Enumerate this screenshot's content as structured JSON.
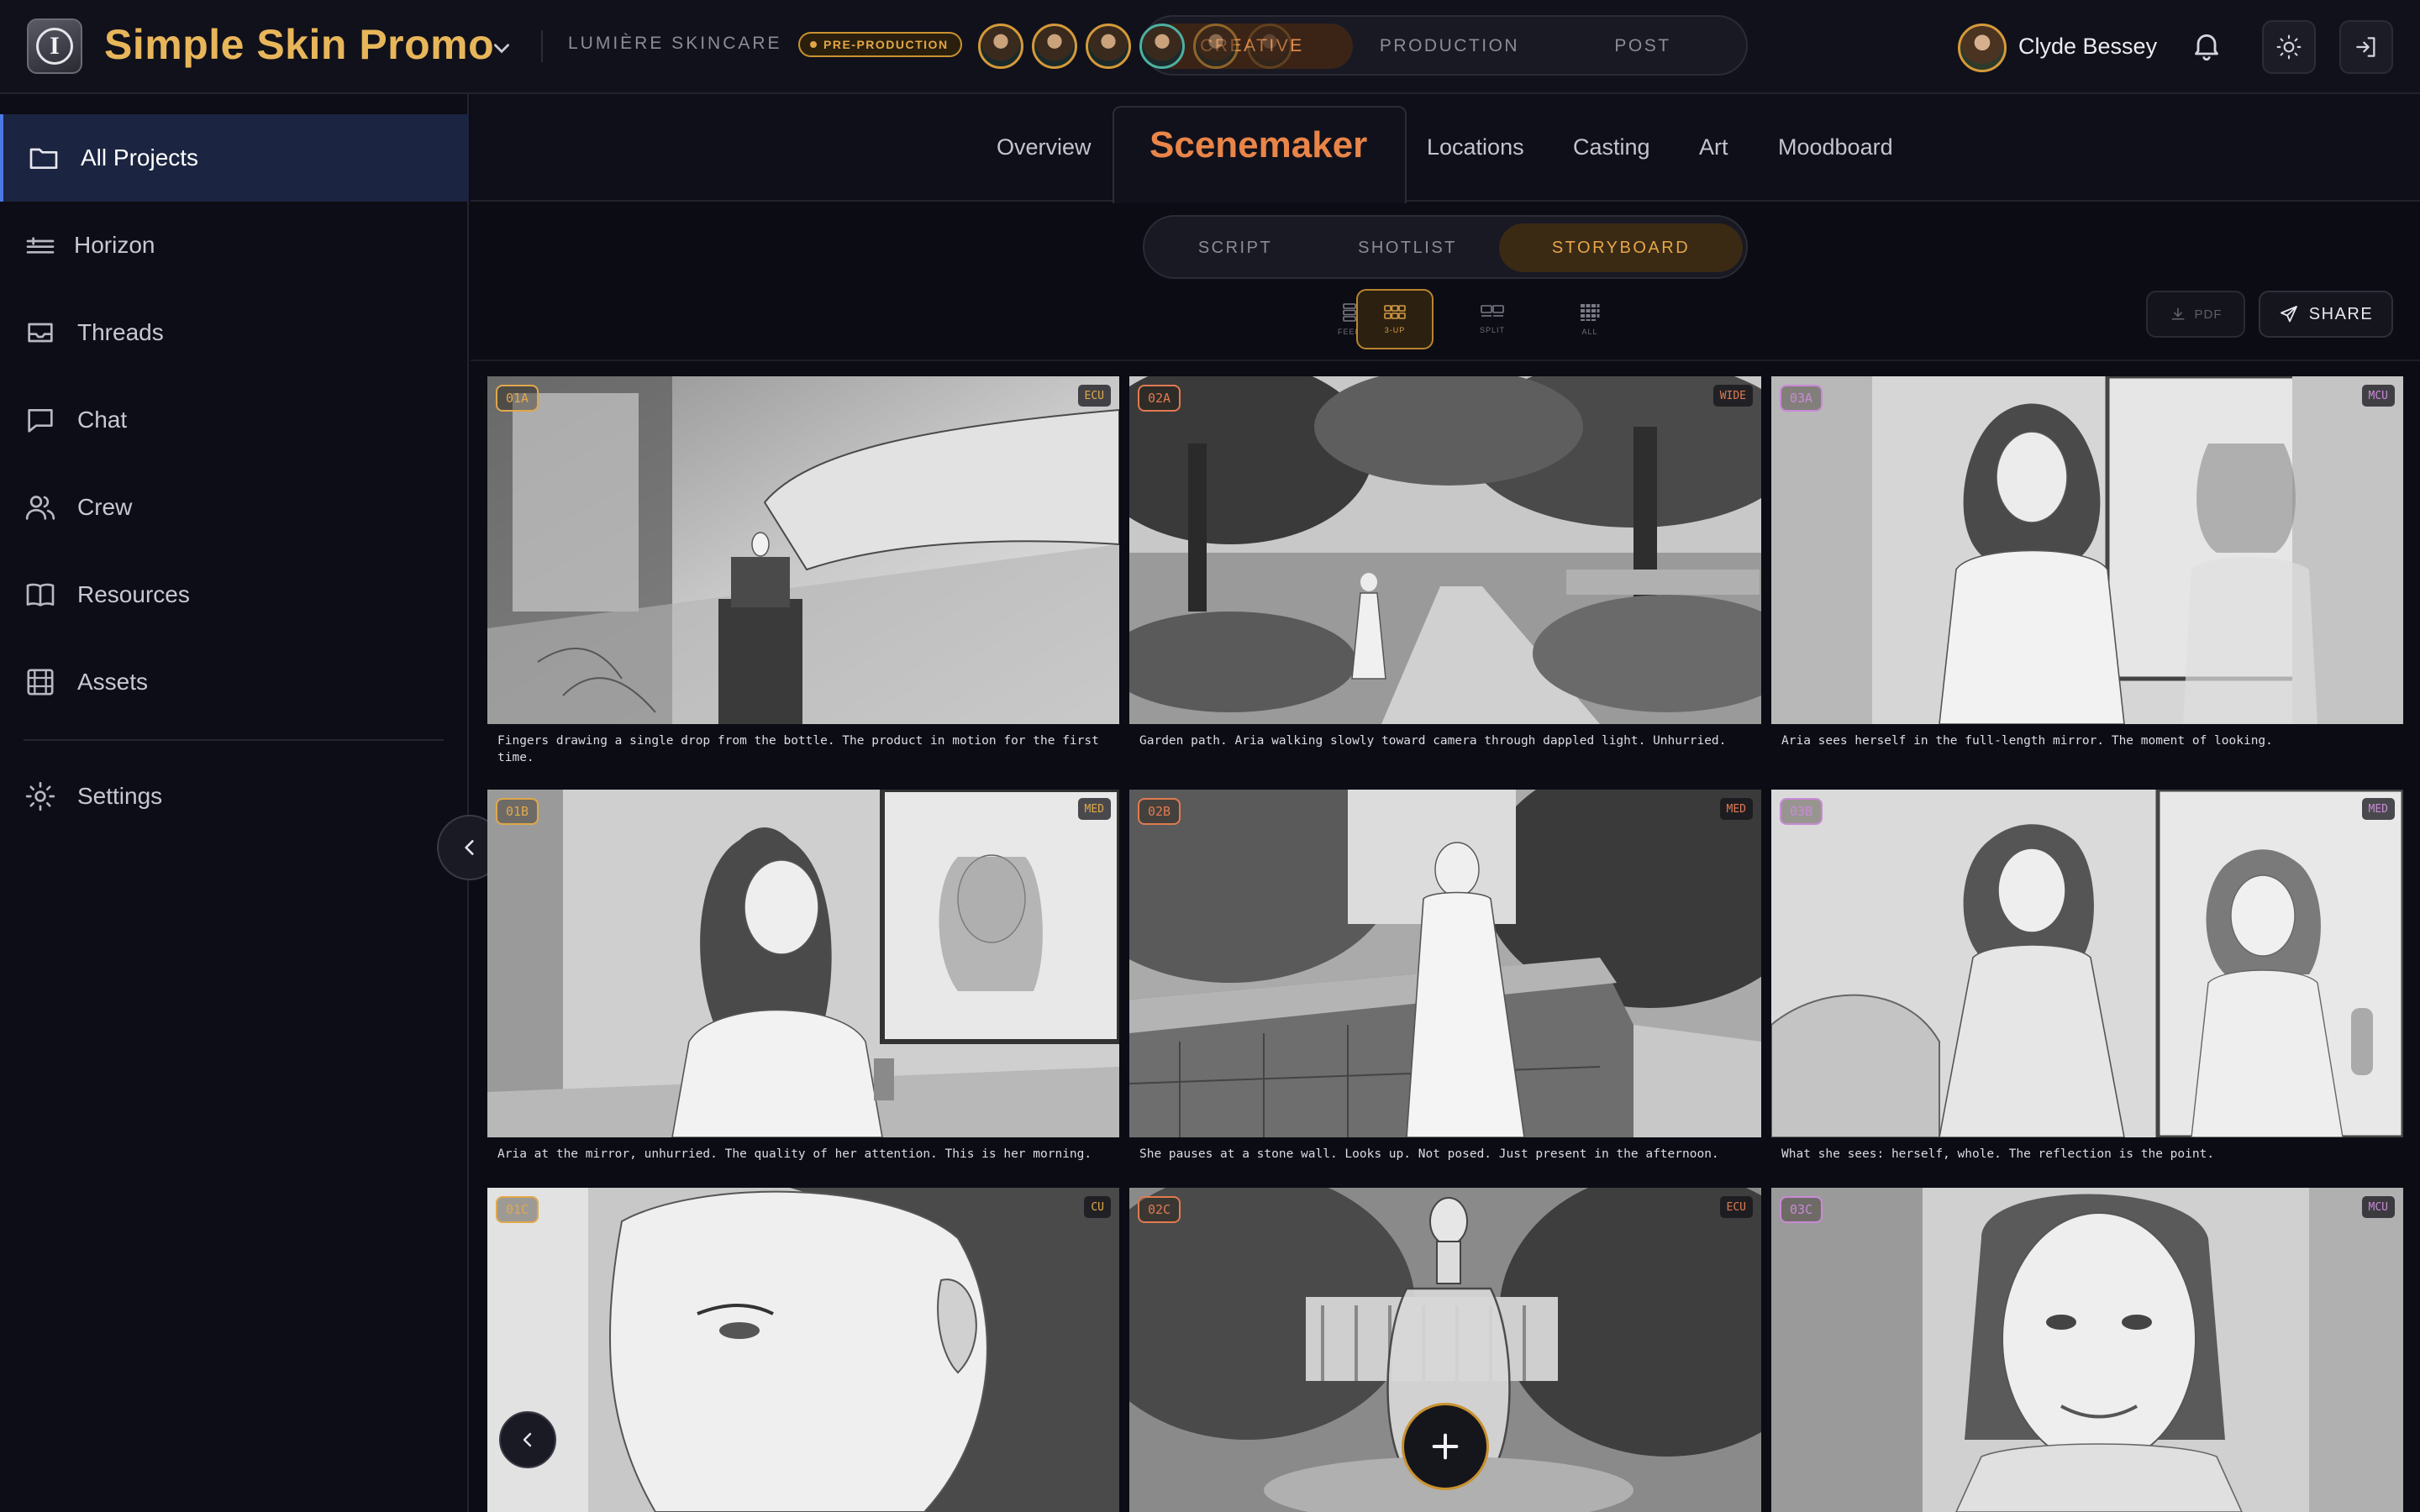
{
  "header": {
    "project_title": "Simple Skin Promo",
    "client": "LUMIÈRE SKINCARE",
    "stage_badge": "PRE-PRODUCTION",
    "phases": [
      "CREATIVE",
      "PRODUCTION",
      "POST"
    ],
    "active_phase": "CREATIVE",
    "user_name": "Clyde Bessey"
  },
  "sidebar": {
    "items": [
      {
        "label": "All Projects",
        "icon": "folder-icon",
        "active": true
      },
      {
        "label": "Horizon",
        "icon": "horizon-lines-icon"
      },
      {
        "label": "Threads",
        "icon": "inbox-icon"
      },
      {
        "label": "Chat",
        "icon": "chat-bubble-icon"
      },
      {
        "label": "Crew",
        "icon": "users-icon"
      },
      {
        "label": "Resources",
        "icon": "book-icon"
      },
      {
        "label": "Assets",
        "icon": "film-grid-icon"
      },
      {
        "label": "Settings",
        "icon": "gear-icon"
      }
    ]
  },
  "section_tabs": [
    "Overview",
    "Scenemaker",
    "Locations",
    "Casting",
    "Art",
    "Moodboard"
  ],
  "active_section": "Scenemaker",
  "view_tabs": [
    "SCRIPT",
    "SHOTLIST",
    "STORYBOARD"
  ],
  "active_view": "STORYBOARD",
  "layout_modes": [
    "FEED",
    "3-UP",
    "SPLIT",
    "ALL"
  ],
  "active_layout": "3-UP",
  "actions": {
    "pdf": "PDF",
    "share": "SHARE"
  },
  "colors": {
    "accent_orange": "#e98548",
    "accent_gold": "#e8b65a",
    "scene1": "#e0a84a",
    "scene2": "#e07a50",
    "scene3": "#c98ad6",
    "nav_active": "#1b2440"
  },
  "shots": [
    {
      "id": "01A",
      "size": "ECU",
      "caption": "Fingers drawing a single drop from the bottle. The product in motion for the first time."
    },
    {
      "id": "02A",
      "size": "WIDE",
      "caption": "Garden path. Aria walking slowly toward camera through dappled light. Unhurried."
    },
    {
      "id": "03A",
      "size": "MCU",
      "caption": "Aria sees herself in the full-length mirror. The moment of looking."
    },
    {
      "id": "01B",
      "size": "MED",
      "caption": "Aria at the mirror, unhurried. The quality of her attention. This is her morning."
    },
    {
      "id": "02B",
      "size": "MED",
      "caption": "She pauses at a stone wall. Looks up. Not posed. Just present in the afternoon."
    },
    {
      "id": "03B",
      "size": "MED",
      "caption": "What she sees: herself, whole. The reflection is the point."
    },
    {
      "id": "01C",
      "size": "CU",
      "caption": ""
    },
    {
      "id": "02C",
      "size": "ECU",
      "caption": ""
    },
    {
      "id": "03C",
      "size": "MCU",
      "caption": ""
    }
  ]
}
